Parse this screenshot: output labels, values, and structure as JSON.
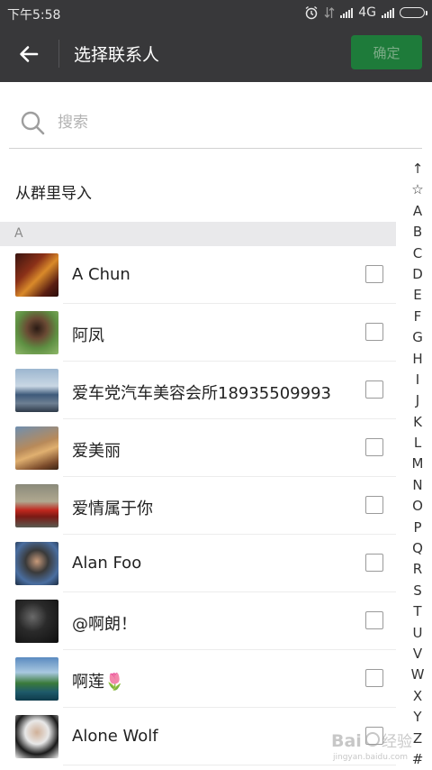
{
  "status_bar": {
    "time": "下午5:58",
    "network": "4G"
  },
  "app_bar": {
    "back_icon": "arrow-left-icon",
    "title": "选择联系人",
    "confirm_label": "确定",
    "colors": {
      "background": "#38383a",
      "confirm": "#1e7b3a"
    }
  },
  "search": {
    "icon": "search-icon",
    "placeholder": "搜索"
  },
  "import_from_group": "从群里导入",
  "section": {
    "letter": "A"
  },
  "contacts": [
    {
      "name": "A Chun",
      "checked": false
    },
    {
      "name": "阿凤",
      "checked": false
    },
    {
      "name": "爱车党汽车美容会所18935509993",
      "checked": false
    },
    {
      "name": "爱美丽",
      "checked": false
    },
    {
      "name": "爱情属于你",
      "checked": false
    },
    {
      "name": "Alan Foo",
      "checked": false
    },
    {
      "name": "@啊朗！",
      "checked": false
    },
    {
      "name": "啊莲🌷",
      "checked": false
    },
    {
      "name": "Alone Wolf",
      "checked": false
    }
  ],
  "alphabet_index": [
    "↑",
    "☆",
    "A",
    "B",
    "C",
    "D",
    "E",
    "F",
    "G",
    "H",
    "I",
    "J",
    "K",
    "L",
    "M",
    "N",
    "O",
    "P",
    "Q",
    "R",
    "S",
    "T",
    "U",
    "V",
    "W",
    "X",
    "Y",
    "Z",
    "#"
  ]
}
